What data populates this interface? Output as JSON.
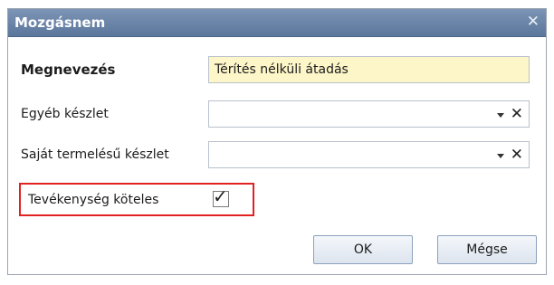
{
  "dialog": {
    "title": "Mozgásnem",
    "close_icon": "close-icon"
  },
  "form": {
    "megnevezes": {
      "label": "Megnevezés",
      "value": "Térítés nélküli átadás",
      "background": "#fdf6c8"
    },
    "egyeb_keszlet": {
      "label": "Egyéb készlet",
      "value": ""
    },
    "sajat_keszlet": {
      "label": "Saját termelésű készlet",
      "value": ""
    },
    "tevekenyseg": {
      "label": "Tevékenység köteles",
      "checked": true
    },
    "dropdown_icon": "chevron-down-icon",
    "clear_icon": "clear-icon",
    "clear_glyph": "✕",
    "check_glyph": "✓"
  },
  "buttons": {
    "ok": "OK",
    "cancel": "Mégse"
  },
  "colors": {
    "titlebar": "#6b85a9",
    "highlight_border": "#e02222"
  }
}
